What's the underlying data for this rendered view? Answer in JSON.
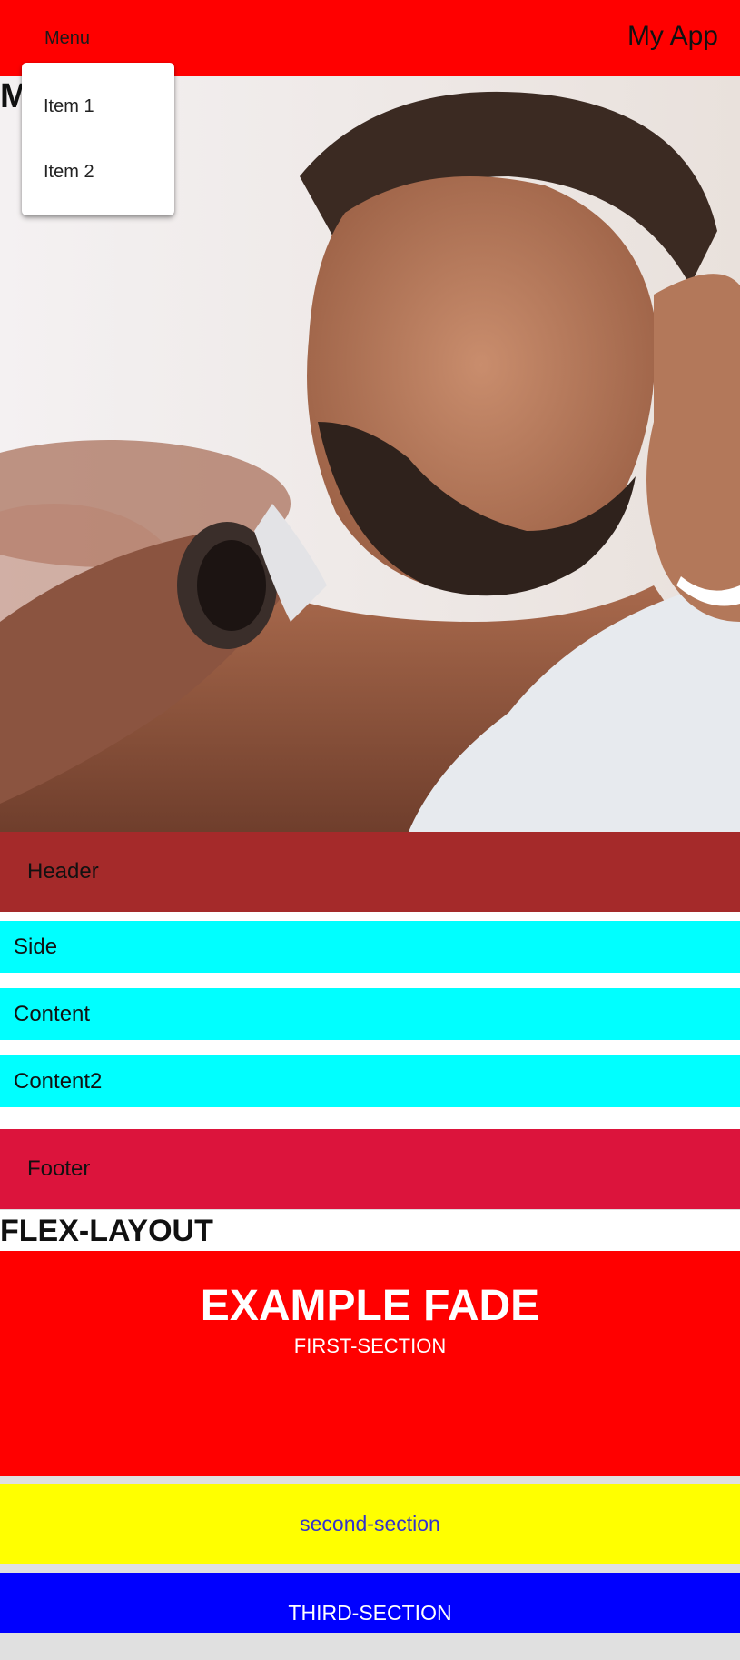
{
  "toolbar": {
    "menu_label": "Menu",
    "app_title": "My App",
    "background": "#ff0000"
  },
  "dropdown": {
    "items": [
      {
        "label": "Item 1"
      },
      {
        "label": "Item 2"
      }
    ]
  },
  "partial_heading": "M",
  "bands": {
    "header": {
      "label": "Header",
      "color": "#a52a2a"
    },
    "side": {
      "label": "Side",
      "color": "#00ffff"
    },
    "content": {
      "label": "Content",
      "color": "#00ffff"
    },
    "content2": {
      "label": "Content2",
      "color": "#00ffff"
    },
    "footer": {
      "label": "Footer",
      "color": "#dc143c"
    }
  },
  "flex_layout_heading": "FLEX-LAYOUT",
  "sections": {
    "first": {
      "title": "EXAMPLE FADE",
      "label": "FIRST-SECTION",
      "color": "#ff0000"
    },
    "second": {
      "label": "second-section",
      "color": "#ffff00"
    },
    "third": {
      "label": "THIRD-SECTION",
      "color": "#0000ff"
    }
  }
}
